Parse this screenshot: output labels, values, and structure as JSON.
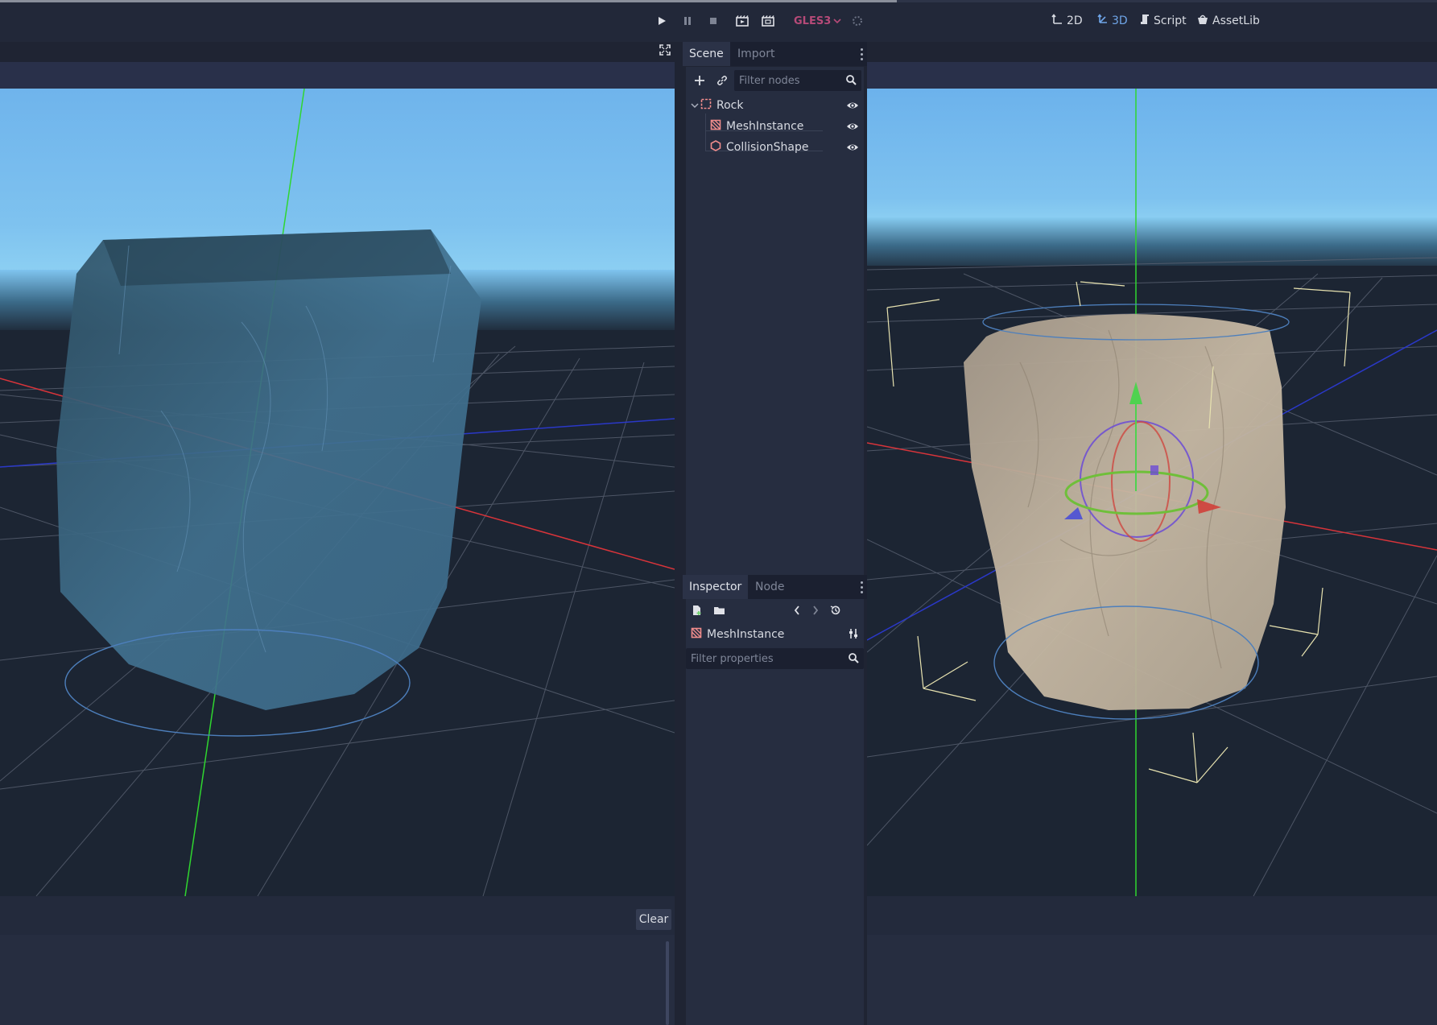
{
  "toolbar": {
    "renderer_label": "GLES3",
    "play_icon": "play-icon",
    "pause_icon": "pause-icon",
    "stop_icon": "stop-icon",
    "play_scene_icon": "play-scene-icon",
    "play_custom_icon": "play-custom-scene-icon"
  },
  "main_tabs": [
    {
      "label": "2D",
      "icon": "2d-icon"
    },
    {
      "label": "3D",
      "icon": "3d-icon"
    },
    {
      "label": "Script",
      "icon": "script-icon"
    },
    {
      "label": "AssetLib",
      "icon": "assetlib-icon"
    }
  ],
  "scene_dock": {
    "tabs": [
      "Scene",
      "Import"
    ],
    "filter_placeholder": "Filter nodes",
    "nodes": [
      {
        "label": "Rock",
        "icon": "spatial-node-icon"
      },
      {
        "label": "MeshInstance",
        "icon": "meshinstance-icon"
      },
      {
        "label": "CollisionShape",
        "icon": "collisionshape-icon"
      }
    ]
  },
  "inspector_dock": {
    "tabs": [
      "Inspector",
      "Node"
    ],
    "object_label": "MeshInstance",
    "filter_placeholder": "Filter properties"
  },
  "output": {
    "clear_label": "Clear"
  },
  "colors": {
    "accent": "#6fa5e8",
    "renderer": "#b64a78",
    "node_icon": "#f08c8c",
    "axis_x": "#e03a3a",
    "axis_y": "#3ad23a",
    "axis_z": "#2f3cd0"
  }
}
